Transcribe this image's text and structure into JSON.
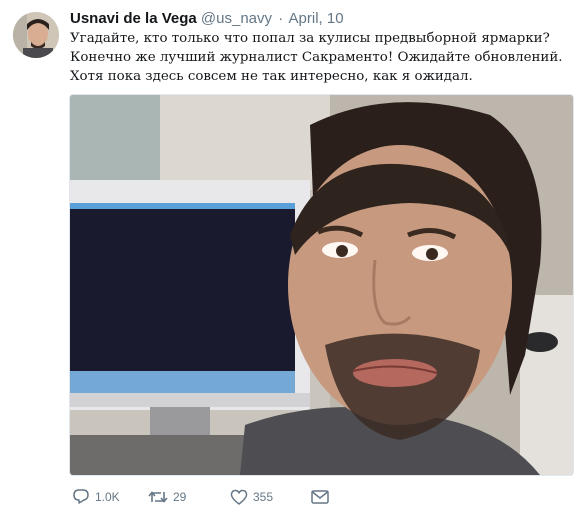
{
  "tweet": {
    "author_name": "Usnavi de la Vega",
    "handle": "@us_navy",
    "separator": "·",
    "date": "April, 10",
    "text_lines": [
      "Угадайте, кто только что попал за кулисы предвыборной ярмарки?",
      "Конечно же лучший журналист Сакраменто! Ожидайте обновлений.",
      "Хотя пока здесь совсем не так интересно, как я ожидал."
    ]
  },
  "actions": {
    "reply": {
      "icon": "reply-icon",
      "count": "1.0K"
    },
    "retweet": {
      "icon": "retweet-icon",
      "count": "29"
    },
    "like": {
      "icon": "heart-icon",
      "count": "355"
    },
    "message": {
      "icon": "envelope-icon"
    }
  },
  "colors": {
    "name": "#14171a",
    "secondary": "#657786",
    "border": "#e1e8ed"
  }
}
